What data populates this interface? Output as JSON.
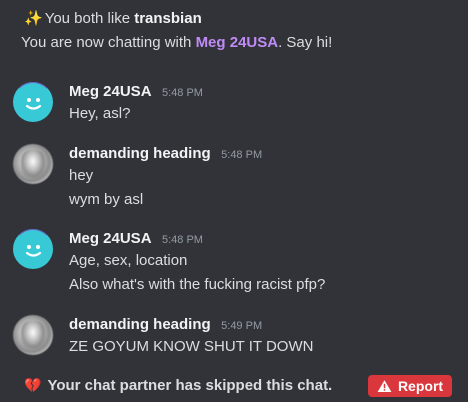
{
  "system": {
    "shared_interest_prefix": "You both like",
    "shared_interest": "transbian",
    "chatting_prefix": "You are now chatting with",
    "partner_name": "Meg 24USA",
    "chatting_suffix": ". Say hi!"
  },
  "messages": [
    {
      "author": "Meg 24USA",
      "time": "5:48 PM",
      "avatar": "smiley-avatar-icon",
      "lines": [
        "Hey, asl?"
      ]
    },
    {
      "author": "demanding heading",
      "time": "5:48 PM",
      "avatar": "blurred-photo-avatar",
      "lines": [
        "hey",
        "wym by asl"
      ]
    },
    {
      "author": "Meg 24USA",
      "time": "5:48 PM",
      "avatar": "smiley-avatar-icon",
      "lines": [
        "Age, sex, location",
        "Also what's with the fucking racist pfp?"
      ]
    },
    {
      "author": "demanding heading",
      "time": "5:49 PM",
      "avatar": "blurred-photo-avatar",
      "lines": [
        "ZE GOYUM KNOW SHUT IT DOWN"
      ]
    }
  ],
  "footer": {
    "skip_text": "Your chat partner has skipped this chat.",
    "report_label": "Report",
    "icons": {
      "skip": "broken-heart-icon",
      "report": "warning-icon"
    }
  },
  "colors": {
    "background": "#313338",
    "partner_name": "#c08bf7",
    "report_button": "#da373c",
    "avatar_teal": "#38c9d6"
  }
}
